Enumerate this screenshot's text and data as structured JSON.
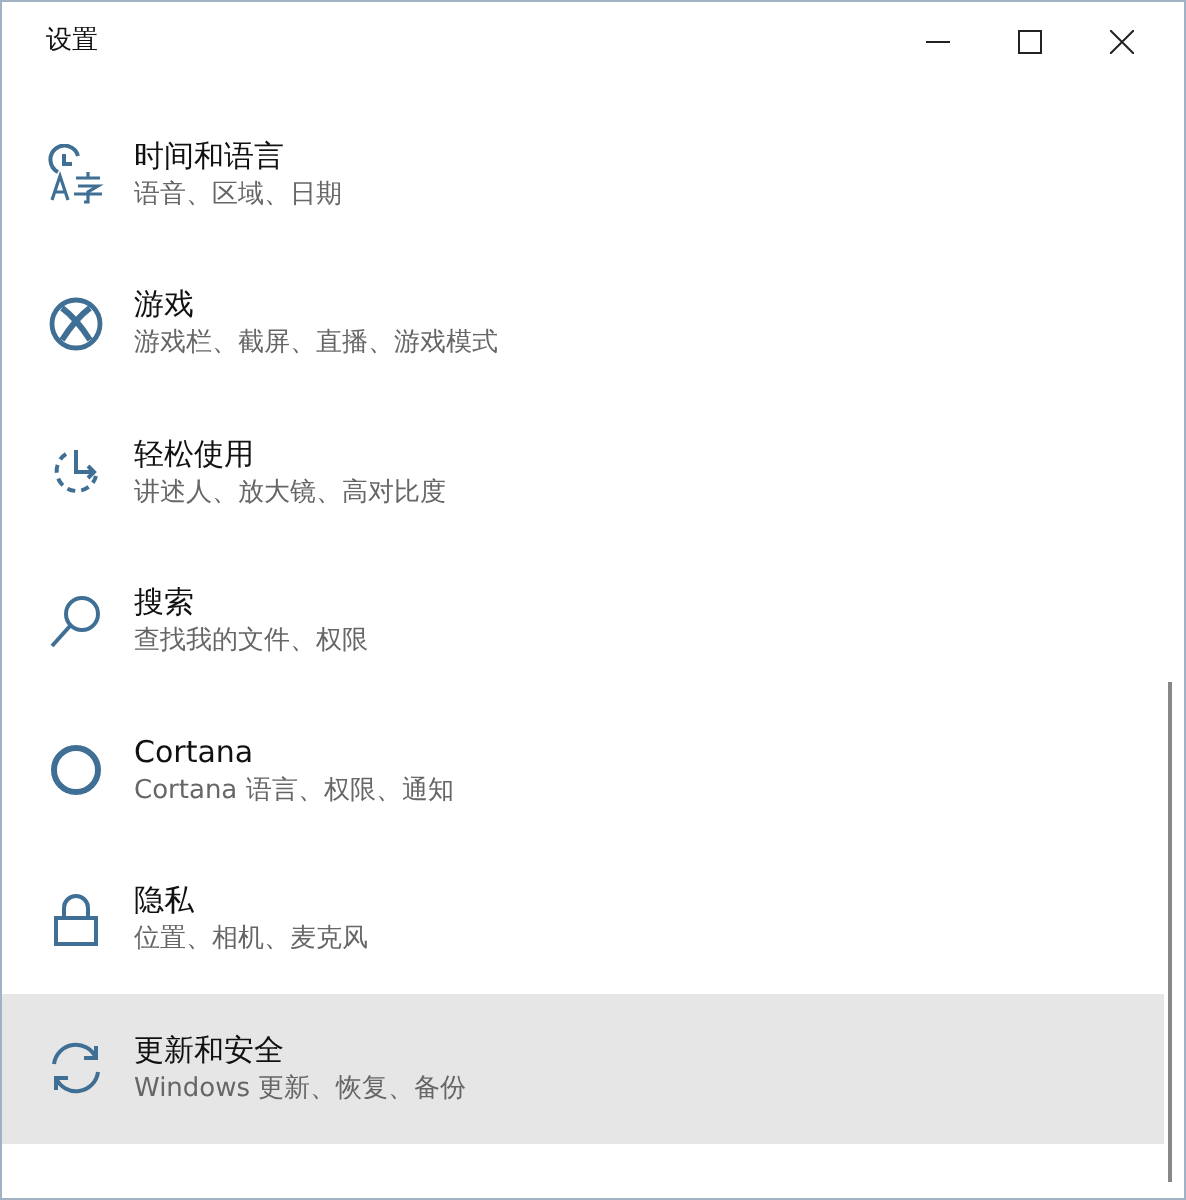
{
  "window": {
    "title": "设置"
  },
  "items": [
    {
      "kind": "time-language",
      "title": "时间和语言",
      "subtitle": "语音、区域、日期",
      "highlighted": false
    },
    {
      "kind": "gaming",
      "title": "游戏",
      "subtitle": "游戏栏、截屏、直播、游戏模式",
      "highlighted": false
    },
    {
      "kind": "ease-of-access",
      "title": "轻松使用",
      "subtitle": "讲述人、放大镜、高对比度",
      "highlighted": false
    },
    {
      "kind": "search",
      "title": "搜索",
      "subtitle": "查找我的文件、权限",
      "highlighted": false
    },
    {
      "kind": "cortana",
      "title": "Cortana",
      "subtitle": "Cortana 语言、权限、通知",
      "highlighted": false
    },
    {
      "kind": "privacy",
      "title": "隐私",
      "subtitle": "位置、相机、麦克风",
      "highlighted": false
    },
    {
      "kind": "update",
      "title": "更新和安全",
      "subtitle": "Windows 更新、恢复、备份",
      "highlighted": true
    }
  ]
}
